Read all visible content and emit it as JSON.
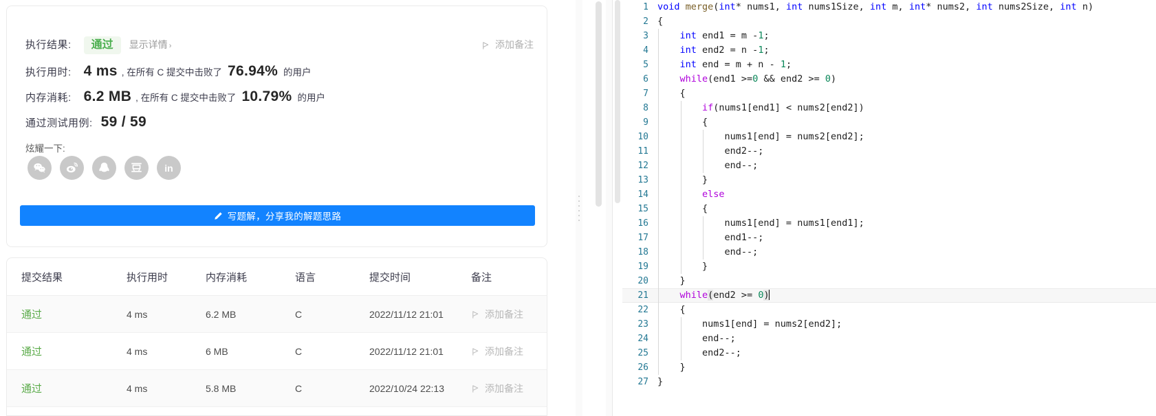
{
  "result_panel": {
    "verdict_label": "执行结果:",
    "verdict_value": "通过",
    "detail_link": "显示详情",
    "detail_chevron": "›",
    "add_note_top": "添加备注",
    "runtime_label": "执行用时:",
    "runtime_value": "4 ms",
    "runtime_prefix": ", 在所有 C 提交中击败了",
    "runtime_percent": "76.94%",
    "runtime_suffix": "的用户",
    "memory_label": "内存消耗:",
    "memory_value": "6.2 MB",
    "memory_prefix": ", 在所有 C 提交中击败了",
    "memory_percent": "10.79%",
    "memory_suffix": "的用户",
    "testcases_label": "通过测试用例:",
    "testcases_value": "59 / 59",
    "share_label": "炫耀一下:",
    "social": [
      {
        "name": "wechat-icon",
        "glyph": ""
      },
      {
        "name": "weibo-icon",
        "glyph": ""
      },
      {
        "name": "qq-icon",
        "glyph": ""
      },
      {
        "name": "douban-icon",
        "glyph": ""
      },
      {
        "name": "linkedin-icon",
        "glyph": "in"
      }
    ],
    "write_solution_button": "写题解，分享我的解题思路",
    "accent_color": "#1283ff",
    "verdict_color": "#4caf50"
  },
  "submissions": {
    "headers": [
      "提交结果",
      "执行用时",
      "内存消耗",
      "语言",
      "提交时间",
      "备注"
    ],
    "note_label": "添加备注",
    "rows": [
      {
        "status": "通过",
        "runtime": "4 ms",
        "memory": "6.2 MB",
        "language": "C",
        "time": "2022/11/12 21:01",
        "note": "添加备注"
      },
      {
        "status": "通过",
        "runtime": "4 ms",
        "memory": "6 MB",
        "language": "C",
        "time": "2022/11/12 21:01",
        "note": "添加备注"
      },
      {
        "status": "通过",
        "runtime": "4 ms",
        "memory": "5.8 MB",
        "language": "C",
        "time": "2022/10/24 22:13",
        "note": "添加备注"
      }
    ]
  },
  "editor": {
    "language": "C",
    "active_line": 21,
    "lines": [
      {
        "n": "1",
        "indent": 0,
        "segs": [
          {
            "t": "void ",
            "c": "kw"
          },
          {
            "t": "merge",
            "c": "fn"
          },
          {
            "t": "("
          },
          {
            "t": "int",
            "c": "kw"
          },
          {
            "t": "* nums1, "
          },
          {
            "t": "int",
            "c": "kw"
          },
          {
            "t": " nums1Size, "
          },
          {
            "t": "int",
            "c": "kw"
          },
          {
            "t": " m, "
          },
          {
            "t": "int",
            "c": "kw"
          },
          {
            "t": "* nums2, "
          },
          {
            "t": "int",
            "c": "kw"
          },
          {
            "t": " nums2Size, "
          },
          {
            "t": "int",
            "c": "kw"
          },
          {
            "t": " n)"
          }
        ]
      },
      {
        "n": "2",
        "indent": 0,
        "segs": [
          {
            "t": "{"
          }
        ]
      },
      {
        "n": "3",
        "indent": 1,
        "segs": [
          {
            "t": "    "
          },
          {
            "t": "int",
            "c": "kw"
          },
          {
            "t": " end1 = m -"
          },
          {
            "t": "1",
            "c": "num"
          },
          {
            "t": ";"
          }
        ]
      },
      {
        "n": "4",
        "indent": 1,
        "segs": [
          {
            "t": "    "
          },
          {
            "t": "int",
            "c": "kw"
          },
          {
            "t": " end2 = n -"
          },
          {
            "t": "1",
            "c": "num"
          },
          {
            "t": ";"
          }
        ]
      },
      {
        "n": "5",
        "indent": 1,
        "segs": [
          {
            "t": "    "
          },
          {
            "t": "int",
            "c": "kw"
          },
          {
            "t": " end = m + n - "
          },
          {
            "t": "1",
            "c": "num"
          },
          {
            "t": ";"
          }
        ]
      },
      {
        "n": "6",
        "indent": 1,
        "segs": [
          {
            "t": "    "
          },
          {
            "t": "while",
            "c": "ctl"
          },
          {
            "t": "(end1 >="
          },
          {
            "t": "0",
            "c": "num"
          },
          {
            "t": " && end2 >= "
          },
          {
            "t": "0",
            "c": "num"
          },
          {
            "t": ")"
          }
        ]
      },
      {
        "n": "7",
        "indent": 1,
        "segs": [
          {
            "t": "    {"
          }
        ]
      },
      {
        "n": "8",
        "indent": 2,
        "segs": [
          {
            "t": "        "
          },
          {
            "t": "if",
            "c": "ctl"
          },
          {
            "t": "(nums1[end1] < nums2[end2])"
          }
        ]
      },
      {
        "n": "9",
        "indent": 2,
        "segs": [
          {
            "t": "        {"
          }
        ]
      },
      {
        "n": "10",
        "indent": 3,
        "segs": [
          {
            "t": "            nums1[end] = nums2[end2];"
          }
        ]
      },
      {
        "n": "11",
        "indent": 3,
        "segs": [
          {
            "t": "            end2--;"
          }
        ]
      },
      {
        "n": "12",
        "indent": 3,
        "segs": [
          {
            "t": "            end--;"
          }
        ]
      },
      {
        "n": "13",
        "indent": 2,
        "segs": [
          {
            "t": "        }"
          }
        ]
      },
      {
        "n": "14",
        "indent": 2,
        "segs": [
          {
            "t": "        "
          },
          {
            "t": "else",
            "c": "ctl"
          }
        ]
      },
      {
        "n": "15",
        "indent": 2,
        "segs": [
          {
            "t": "        {"
          }
        ]
      },
      {
        "n": "16",
        "indent": 3,
        "segs": [
          {
            "t": "            nums1[end] = nums1[end1];"
          }
        ]
      },
      {
        "n": "17",
        "indent": 3,
        "segs": [
          {
            "t": "            end1--;"
          }
        ]
      },
      {
        "n": "18",
        "indent": 3,
        "segs": [
          {
            "t": "            end--;"
          }
        ]
      },
      {
        "n": "19",
        "indent": 2,
        "segs": [
          {
            "t": "        }"
          }
        ]
      },
      {
        "n": "20",
        "indent": 1,
        "segs": [
          {
            "t": "    }"
          }
        ]
      },
      {
        "n": "21",
        "indent": 1,
        "active": true,
        "segs": [
          {
            "t": "    "
          },
          {
            "t": "while",
            "c": "ctl"
          },
          {
            "t": "(",
            "c": "hl"
          },
          {
            "t": "end2 >= "
          },
          {
            "t": "0",
            "c": "num"
          },
          {
            "t": ")",
            "c": "hl"
          },
          {
            "t": "",
            "caret": true
          }
        ]
      },
      {
        "n": "22",
        "indent": 1,
        "segs": [
          {
            "t": "    {"
          }
        ]
      },
      {
        "n": "23",
        "indent": 2,
        "segs": [
          {
            "t": "        nums1[end] = nums2[end2];"
          }
        ]
      },
      {
        "n": "24",
        "indent": 2,
        "segs": [
          {
            "t": "        end--;"
          }
        ]
      },
      {
        "n": "25",
        "indent": 2,
        "segs": [
          {
            "t": "        end2--;"
          }
        ]
      },
      {
        "n": "26",
        "indent": 1,
        "segs": [
          {
            "t": "    }"
          }
        ]
      },
      {
        "n": "27",
        "indent": 0,
        "segs": [
          {
            "t": "}"
          }
        ]
      }
    ]
  }
}
